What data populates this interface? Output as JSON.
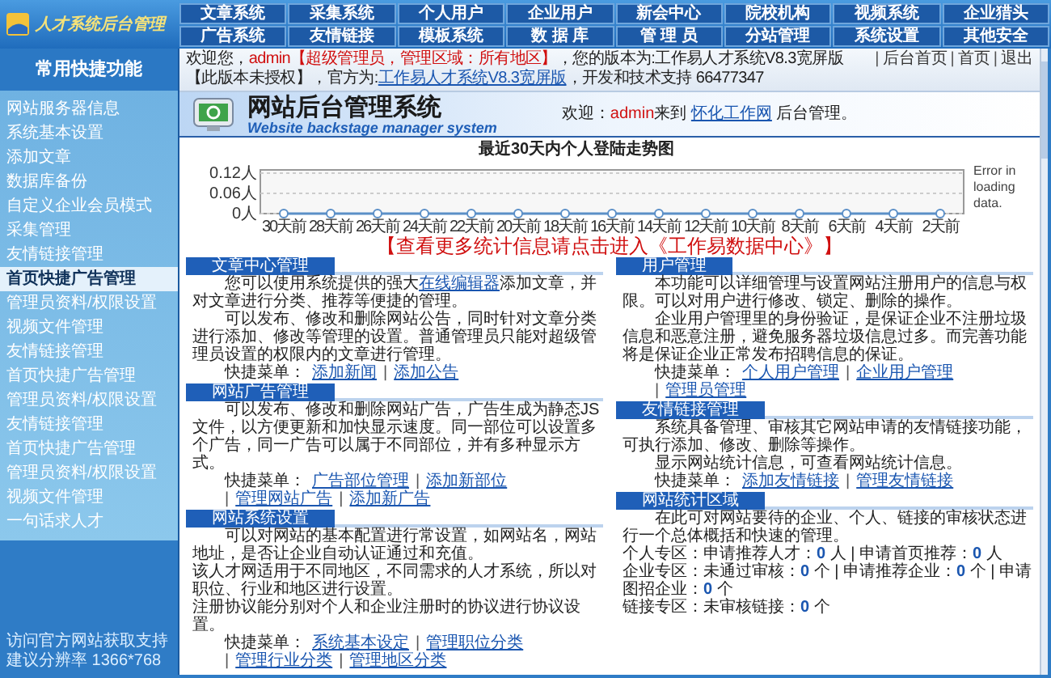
{
  "header": {
    "logo": "人才系统后台管理",
    "nav": [
      "文章系统",
      "采集系统",
      "个人用户",
      "企业用户",
      "新会中心",
      "院校机构",
      "视频系统",
      "企业猎头",
      "广告系统",
      "友情链接",
      "模板系统",
      "数 据 库",
      "管 理 员",
      "分站管理",
      "系统设置",
      "其他安全"
    ]
  },
  "sidebar": {
    "title": "常用快捷功能",
    "items": [
      {
        "label": "网站服务器信息",
        "selected": false
      },
      {
        "label": "系统基本设置",
        "selected": false
      },
      {
        "label": "添加文章",
        "selected": false
      },
      {
        "label": "数据库备份",
        "selected": false
      },
      {
        "label": "自定义企业会员模式",
        "selected": false
      },
      {
        "label": "采集管理",
        "selected": false
      },
      {
        "label": "友情链接管理",
        "selected": false
      },
      {
        "label": "首页快捷广告管理",
        "selected": true
      },
      {
        "label": "管理员资料/权限设置",
        "selected": false
      },
      {
        "label": "视频文件管理",
        "selected": false
      },
      {
        "label": "友情链接管理",
        "selected": false
      },
      {
        "label": "首页快捷广告管理",
        "selected": false
      },
      {
        "label": "管理员资料/权限设置",
        "selected": false
      },
      {
        "label": "友情链接管理",
        "selected": false
      },
      {
        "label": "首页快捷广告管理",
        "selected": false
      },
      {
        "label": "管理员资料/权限设置",
        "selected": false
      },
      {
        "label": "视频文件管理",
        "selected": false
      },
      {
        "label": "一句话求人才",
        "selected": false
      }
    ],
    "footer": [
      "访问官方网站获取支持",
      "建议分辨率 1366*768"
    ]
  },
  "info_bar": {
    "segments": [
      {
        "kind": "text",
        "text": "欢迎您，"
      },
      {
        "kind": "red",
        "text": "admin【超级管理员，管理区域：所有地区】"
      },
      {
        "kind": "text",
        "text": "，您的版本为:工作易人才系统V8.3宽屏版【此版本未授权】，官方为:"
      },
      {
        "kind": "link",
        "text": "工作易人才系统V8.3宽屏版"
      },
      {
        "kind": "text",
        "text": "，开发和技术支持 66477347"
      }
    ],
    "separator": "|",
    "links": [
      "后台首页",
      "首页",
      "退出"
    ]
  },
  "banner": {
    "title": "网站后台管理系统",
    "subtitle": "Website backstage manager system",
    "welcome": [
      {
        "kind": "text",
        "text": "欢迎："
      },
      {
        "kind": "red",
        "text": "admin"
      },
      {
        "kind": "text",
        "text": "来到 "
      },
      {
        "kind": "link",
        "text": "怀化工作网"
      },
      {
        "kind": "text",
        "text": " 后台管理。"
      }
    ]
  },
  "chart": {
    "error": "Error in loading data.",
    "chart_data": {
      "type": "line",
      "title": "最近30天内个人登陆走势图",
      "categories": [
        "30天前",
        "28天前",
        "26天前",
        "24天前",
        "22天前",
        "20天前",
        "18天前",
        "16天前",
        "14天前",
        "12天前",
        "10天前",
        "8天前",
        "6天前",
        "4天前",
        "2天前"
      ],
      "series": [
        {
          "color": "#5b8fc7",
          "marker": "circle",
          "values": [
            0,
            0,
            0,
            0,
            0,
            0,
            0,
            0,
            0,
            0,
            0,
            0,
            0,
            0,
            0
          ]
        }
      ],
      "ylim": [
        0,
        0.12
      ],
      "yticks": [
        {
          "value": 0,
          "label": "0人"
        },
        {
          "value": 0.06,
          "label": "0.06人"
        },
        {
          "value": 0.12,
          "label": "0.12人"
        }
      ]
    }
  },
  "stats_link": "【查看更多统计信息请点击进入《工作易数据中心》】",
  "panels_left": [
    {
      "title": "文章中心管理",
      "paragraphs": [
        {
          "indent": true,
          "segments": [
            {
              "kind": "text",
              "text": "您可以使用系统提供的强大"
            },
            {
              "kind": "link",
              "text": "在线编辑器"
            },
            {
              "kind": "text",
              "text": "添加文章，并对文章进行分类、推荐等便捷的管理。"
            }
          ]
        },
        {
          "indent": true,
          "segments": [
            {
              "kind": "text",
              "text": "可以发布、修改和删除网站公告，同时针对文章分类进行添加、修改等管理的设置。普通管理员只能对超级管理员设置的权限内的文章进行管理。"
            }
          ]
        }
      ],
      "menu": {
        "label": "快捷菜单：",
        "separator": "|",
        "links": [
          "添加新闻",
          "添加公告"
        ]
      }
    },
    {
      "title": "网站广告管理",
      "paragraphs": [
        {
          "indent": true,
          "segments": [
            {
              "kind": "text",
              "text": "可以发布、修改和删除网站广告，广告生成为静态JS文件，以方便更新和加快显示速度。同一部位可以设置多个广告，同一广告可以属于不同部位，并有多种显示方式。"
            }
          ]
        }
      ],
      "menu": {
        "label": "快捷菜单：",
        "separator": "|",
        "links": [
          "广告部位管理",
          "添加新部位",
          "管理网站广告",
          "添加新广告"
        ]
      }
    },
    {
      "title": "网站系统设置",
      "paragraphs": [
        {
          "indent": true,
          "segments": [
            {
              "kind": "text",
              "text": "可以对网站的基本配置进行常设置，如网站名，网站地址，是否让企业自动认证通过和充值。"
            }
          ]
        },
        {
          "indent": false,
          "segments": [
            {
              "kind": "text",
              "text": "该人才网适用于不同地区，不同需求的人才系统，所以对职位、行业和地区进行设置。"
            }
          ]
        },
        {
          "indent": false,
          "segments": [
            {
              "kind": "text",
              "text": "注册协议能分别对个人和企业注册时的协议进行协议设置。"
            }
          ]
        }
      ],
      "menu": {
        "label": "快捷菜单：",
        "separator": "|",
        "links": [
          "系统基本设定",
          "管理职位分类",
          "管理行业分类",
          "管理地区分类"
        ]
      }
    }
  ],
  "panels_right": [
    {
      "title": "用户管理",
      "paragraphs": [
        {
          "indent": true,
          "segments": [
            {
              "kind": "text",
              "text": "本功能可以详细管理与设置网站注册用户的信息与权限。可以对用户进行修改、锁定、删除的操作。"
            }
          ]
        },
        {
          "indent": true,
          "segments": [
            {
              "kind": "text",
              "text": "企业用户管理里的身份验证，是保证企业不注册垃圾信息和恶意注册，避免服务器垃圾信息过多。而完善功能将是保证企业正常发布招聘信息的保证。"
            }
          ]
        }
      ],
      "menu": {
        "label": "快捷菜单：",
        "separator": "|",
        "links": [
          "个人用户管理",
          "企业用户管理",
          "管理员管理"
        ]
      }
    },
    {
      "title": "友情链接管理",
      "paragraphs": [
        {
          "indent": true,
          "segments": [
            {
              "kind": "text",
              "text": "系统具备管理、审核其它网站申请的友情链接功能，可执行添加、修改、删除等操作。"
            }
          ]
        },
        {
          "indent": true,
          "segments": [
            {
              "kind": "text",
              "text": "显示网站统计信息，可查看网站统计信息。"
            }
          ]
        }
      ],
      "menu": {
        "label": "快捷菜单：",
        "separator": "|",
        "links": [
          "添加友情链接",
          "管理友情链接"
        ]
      }
    },
    {
      "title": "网站统计区域",
      "paragraphs": [
        {
          "indent": true,
          "segments": [
            {
              "kind": "text",
              "text": "在此可对网站要待的企业、个人、链接的审核状态进行一个总体概括和快速的管理。"
            }
          ]
        },
        {
          "indent": false,
          "segments": [
            {
              "kind": "text",
              "text": "个人专区：申请推荐人才："
            },
            {
              "kind": "value",
              "text": "0"
            },
            {
              "kind": "text",
              "text": " 人 | 申请首页推荐："
            },
            {
              "kind": "value",
              "text": "0"
            },
            {
              "kind": "text",
              "text": " 人"
            }
          ]
        },
        {
          "indent": false,
          "segments": [
            {
              "kind": "text",
              "text": "企业专区：未通过审核："
            },
            {
              "kind": "value",
              "text": "0"
            },
            {
              "kind": "text",
              "text": " 个 | 申请推荐企业："
            },
            {
              "kind": "value",
              "text": "0"
            },
            {
              "kind": "text",
              "text": " 个 | 申请图招企业："
            },
            {
              "kind": "value",
              "text": "0"
            },
            {
              "kind": "text",
              "text": " 个"
            }
          ]
        },
        {
          "indent": false,
          "segments": [
            {
              "kind": "text",
              "text": "链接专区：未审核链接："
            },
            {
              "kind": "value",
              "text": "0"
            },
            {
              "kind": "text",
              "text": " 个"
            }
          ]
        }
      ]
    }
  ]
}
